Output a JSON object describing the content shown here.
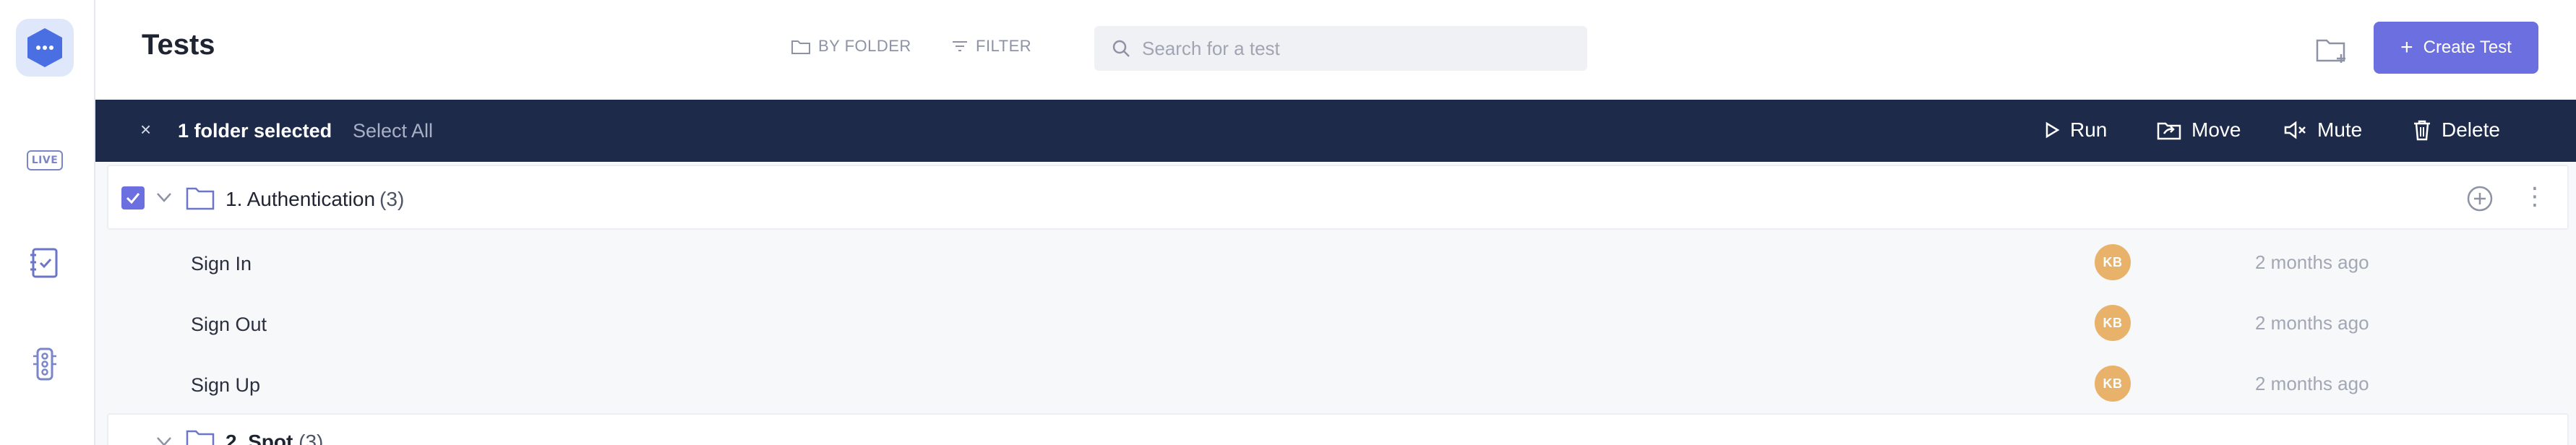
{
  "header": {
    "title": "Tests",
    "by_folder_label": "BY FOLDER",
    "filter_label": "FILTER",
    "search_placeholder": "Search for a test",
    "create_test_label": "Create Test"
  },
  "sidebar": {
    "live_label": "LIVE"
  },
  "selection_bar": {
    "close_glyph": "×",
    "count_text": "1 folder selected",
    "select_all_label": "Select All",
    "actions": {
      "run": "Run",
      "move": "Move",
      "mute": "Mute",
      "delete": "Delete"
    }
  },
  "folders": [
    {
      "name": "1. Authentication",
      "count": "(3)",
      "checked": true,
      "tests": [
        {
          "name": "Sign In",
          "author_initials": "KB",
          "updated": "2 months ago"
        },
        {
          "name": "Sign Out",
          "author_initials": "KB",
          "updated": "2 months ago"
        },
        {
          "name": "Sign Up",
          "author_initials": "KB",
          "updated": "2 months ago"
        }
      ]
    },
    {
      "name": "2. Spot",
      "count": "(3)",
      "checked": false
    }
  ],
  "colors": {
    "accent": "#6b6fe0",
    "selection_bar": "#1e2a4a",
    "avatar": "#e9b26a",
    "logo": "#4a6fe3"
  },
  "icons": {
    "logo": "hexagon-dots-icon",
    "live": "live-icon",
    "tests": "checklist-icon",
    "traffic": "traffic-light-icon",
    "by_folder": "folder-icon",
    "filter": "filter-icon",
    "search": "search-icon",
    "new_folder": "folder-plus-icon",
    "create": "plus-icon",
    "run": "play-icon",
    "move": "folder-move-icon",
    "mute": "mute-icon",
    "delete": "trash-icon",
    "add": "plus-circle-icon",
    "more": "more-vertical-icon"
  }
}
